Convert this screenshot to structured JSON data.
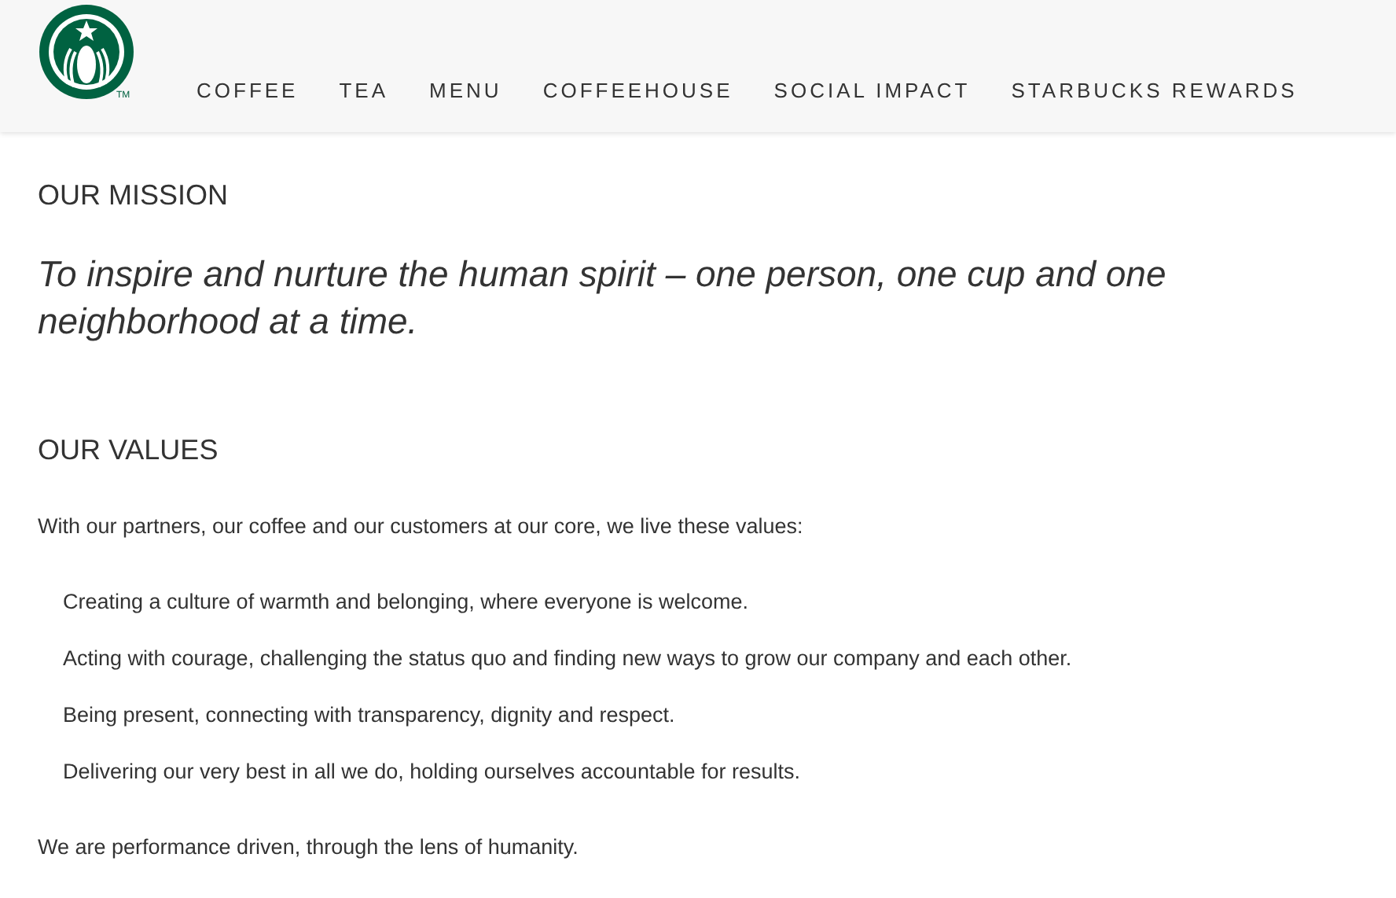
{
  "header": {
    "logo": {
      "trademark": "TM"
    },
    "nav": [
      {
        "label": "COFFEE"
      },
      {
        "label": "TEA"
      },
      {
        "label": "MENU"
      },
      {
        "label": "COFFEEHOUSE"
      },
      {
        "label": "SOCIAL IMPACT"
      },
      {
        "label": "STARBUCKS REWARDS"
      }
    ]
  },
  "mission": {
    "heading": "OUR MISSION",
    "statement": "To inspire and nurture the human spirit – one person, one cup and one neighborhood at a time."
  },
  "values": {
    "heading": "OUR VALUES",
    "intro": "With our partners, our coffee and our customers at our core, we live these values:",
    "items": [
      "Creating a culture of warmth and belonging, where everyone is welcome.",
      "Acting with courage, challenging the status quo and finding new ways to grow our company and each other.",
      "Being present, connecting with transparency, dignity and respect.",
      "Delivering our very best in all we do, holding ourselves accountable for results."
    ],
    "closing": "We are performance driven, through the lens of humanity."
  }
}
